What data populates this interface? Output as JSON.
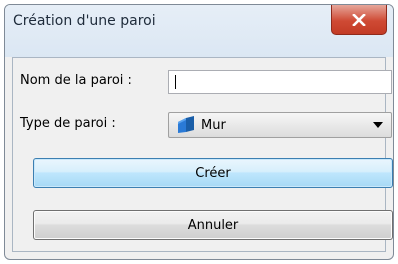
{
  "window": {
    "title": "Création d'une paroi"
  },
  "form": {
    "name_label": "Nom de la paroi :",
    "name_value": "",
    "type_label": "Type de paroi :",
    "type_selected": "Mur",
    "type_icon": "wall-icon"
  },
  "buttons": {
    "create_label": "Créer",
    "cancel_label": "Annuler"
  },
  "colors": {
    "close_button": "#c93f2a",
    "default_button_border": "#3c7fb1",
    "wall_icon": "#1f6fc4"
  }
}
